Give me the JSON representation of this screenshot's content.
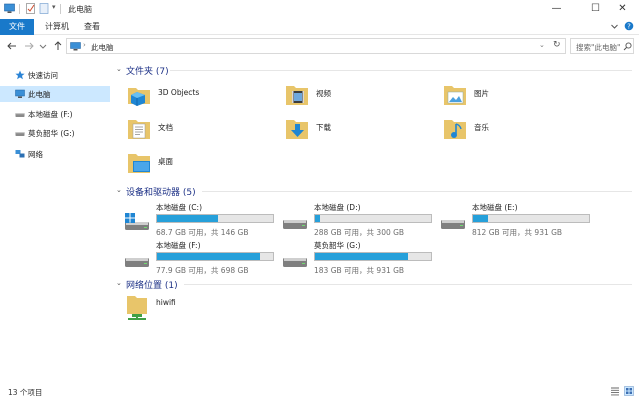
{
  "window": {
    "title": "此电脑",
    "controls": {
      "minimize": "—",
      "maximize": "☐",
      "close": "✕"
    }
  },
  "ribbon": {
    "tabs": [
      "文件",
      "计算机",
      "查看"
    ],
    "expand_icon": "chevron-down-icon",
    "help_icon": "help-icon"
  },
  "address": {
    "path": "此电脑",
    "search_placeholder": "搜索\"此电脑\""
  },
  "nav": {
    "items": [
      {
        "label": "快速访问",
        "icon": "star-icon"
      },
      {
        "label": "此电脑",
        "icon": "computer-icon",
        "selected": true
      },
      {
        "label": "本地磁盘 (F:)",
        "icon": "drive-icon"
      },
      {
        "label": "莫负韶华 (G:)",
        "icon": "drive-icon"
      },
      {
        "label": "网络",
        "icon": "network-icon"
      }
    ]
  },
  "groups": {
    "folders": {
      "title": "文件夹 (7)",
      "items": [
        {
          "label": "3D Objects",
          "icon": "3d-objects-folder-icon"
        },
        {
          "label": "视频",
          "icon": "videos-folder-icon"
        },
        {
          "label": "图片",
          "icon": "pictures-folder-icon"
        },
        {
          "label": "文档",
          "icon": "documents-folder-icon"
        },
        {
          "label": "下载",
          "icon": "downloads-folder-icon"
        },
        {
          "label": "音乐",
          "icon": "music-folder-icon"
        },
        {
          "label": "桌面",
          "icon": "desktop-folder-icon"
        }
      ]
    },
    "drives": {
      "title": "设备和驱动器 (5)",
      "items": [
        {
          "label": "本地磁盘 (C:)",
          "free": "68.7 GB 可用，共 146 GB",
          "used_fraction": 0.53,
          "windows": true
        },
        {
          "label": "本地磁盘 (D:)",
          "free": "288 GB 可用，共 300 GB",
          "used_fraction": 0.04
        },
        {
          "label": "本地磁盘 (E:)",
          "free": "812 GB 可用，共 931 GB",
          "used_fraction": 0.13
        },
        {
          "label": "本地磁盘 (F:)",
          "free": "77.9 GB 可用，共 698 GB",
          "used_fraction": 0.89
        },
        {
          "label": "莫负韶华 (G:)",
          "free": "183 GB 可用，共 931 GB",
          "used_fraction": 0.8
        }
      ],
      "bar_color": "#26a0da"
    },
    "network": {
      "title": "网络位置 (1)",
      "items": [
        {
          "label": "hiwifi",
          "icon": "network-share-icon"
        }
      ]
    }
  },
  "status": {
    "text": "13 个项目"
  },
  "colors": {
    "accent": "#1979ca",
    "selected": "#cce8ff",
    "header": "#1e3287"
  }
}
